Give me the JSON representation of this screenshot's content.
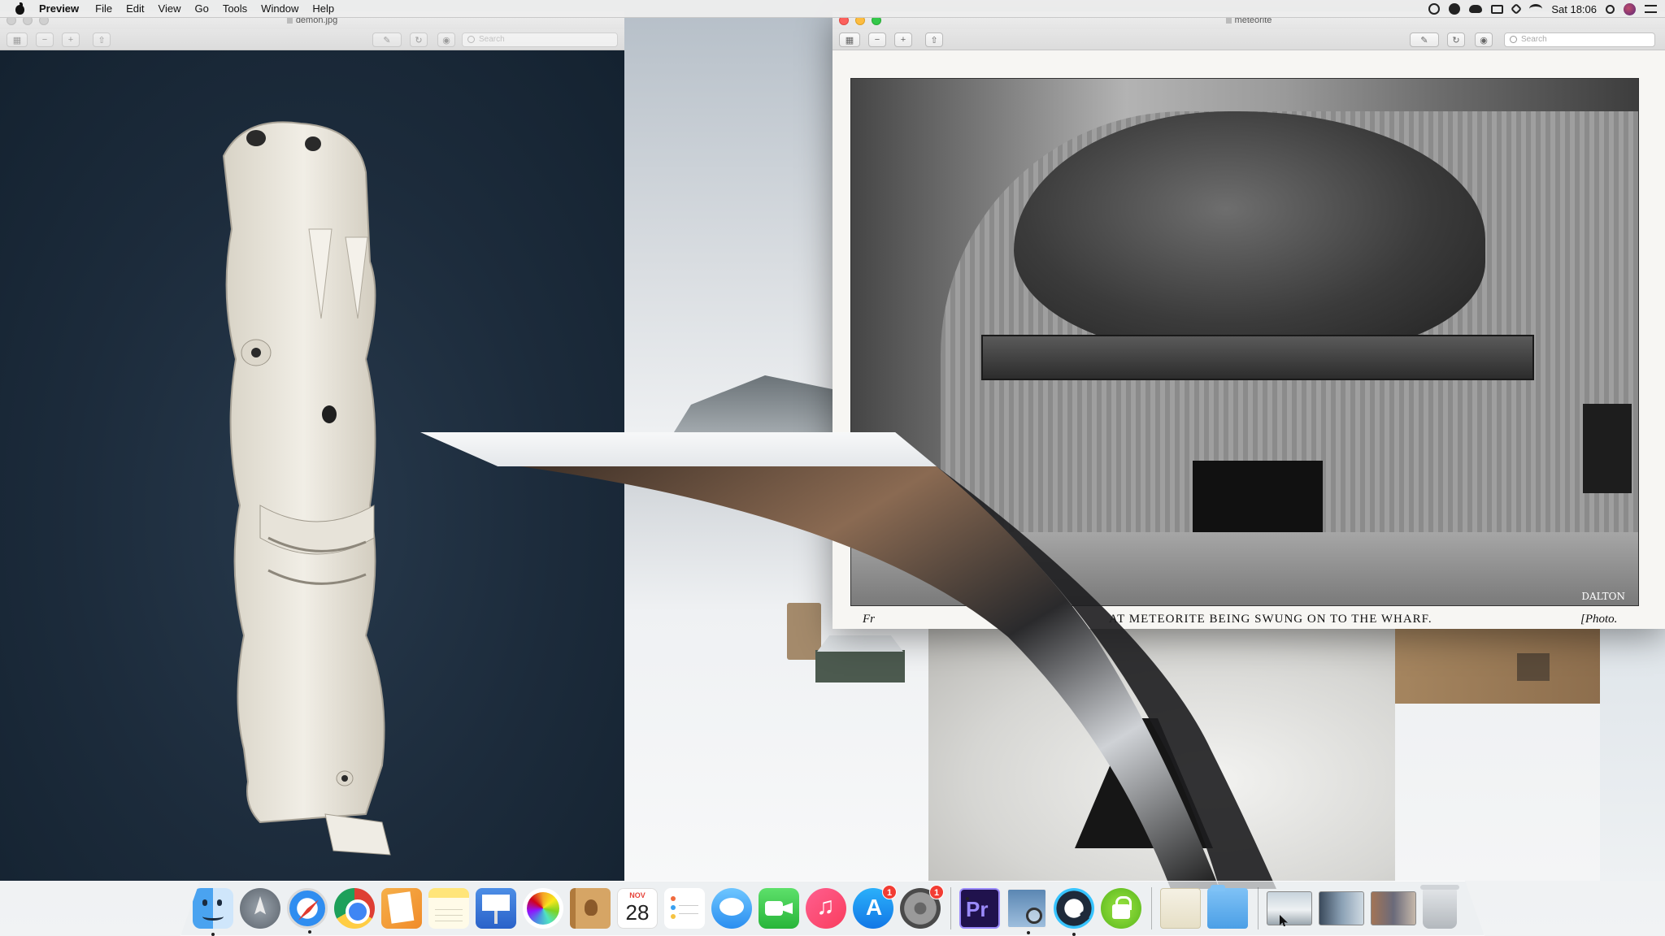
{
  "menubar": {
    "app_name": "Preview",
    "menus": [
      "File",
      "Edit",
      "View",
      "Go",
      "Tools",
      "Window",
      "Help"
    ],
    "clock": "Sat 18:06",
    "status_icons": [
      "screen-record-icon",
      "transfer-icon",
      "creative-cloud-icon",
      "airplay-icon",
      "sparkle-icon",
      "wifi-icon",
      "spotlight-icon",
      "user-avatar-icon",
      "notification-center-icon"
    ]
  },
  "windows": {
    "demon": {
      "title": "demon.jpg",
      "search_placeholder": "Search",
      "state": "inactive"
    },
    "meteorite": {
      "title": "meteorite",
      "search_placeholder": "Search",
      "state": "active",
      "photo_signature": "DALTON",
      "caption_left": "Fr",
      "caption_main": "AT METEORITE BEING SWUNG ON TO THE WHARF.",
      "caption_right": "[Photo."
    }
  },
  "dock": {
    "calendar": {
      "month": "NOV",
      "day": "28"
    },
    "items": [
      {
        "name": "finder-icon"
      },
      {
        "name": "launchpad-icon"
      },
      {
        "name": "safari-icon"
      },
      {
        "name": "chrome-icon"
      },
      {
        "name": "pages-icon"
      },
      {
        "name": "notes-icon"
      },
      {
        "name": "keynote-icon"
      },
      {
        "name": "photos-icon"
      },
      {
        "name": "contacts-icon"
      },
      {
        "name": "calendar-icon"
      },
      {
        "name": "reminders-icon"
      },
      {
        "name": "messages-icon"
      },
      {
        "name": "facetime-icon"
      },
      {
        "name": "itunes-icon"
      },
      {
        "name": "app-store-icon",
        "badge": "1"
      },
      {
        "name": "system-preferences-icon",
        "badge": "1"
      },
      {
        "name": "premiere-pro-icon",
        "label": "Pr"
      },
      {
        "name": "preview-icon"
      },
      {
        "name": "quicktime-icon"
      },
      {
        "name": "vpn-icon"
      },
      {
        "name": "documents-stack-icon"
      },
      {
        "name": "folder-icon"
      },
      {
        "name": "window-thumbnail-1"
      },
      {
        "name": "window-thumbnail-2"
      },
      {
        "name": "window-thumbnail-3"
      },
      {
        "name": "trash-icon"
      }
    ]
  },
  "colors": {
    "close": "#fc605c",
    "minimize": "#fdbc40",
    "zoom": "#34c84a",
    "badge": "#f23c33",
    "desktop_navy": "#1c2b3b"
  }
}
